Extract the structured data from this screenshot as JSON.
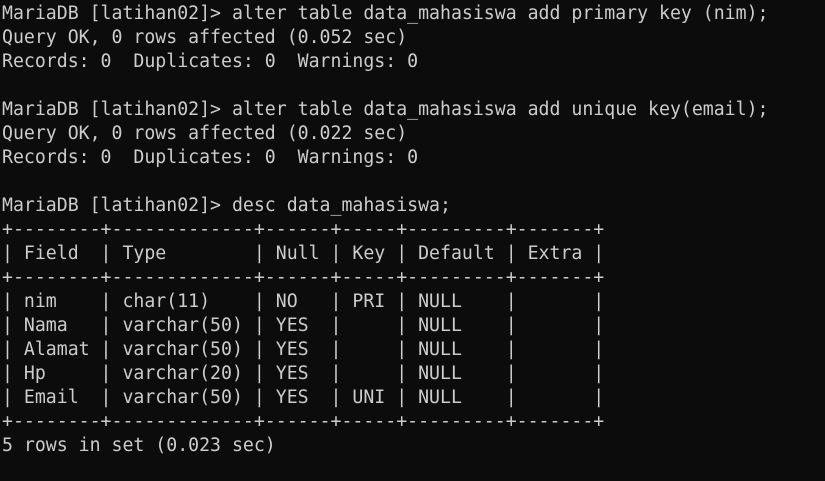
{
  "terminal": {
    "background": "#0c0c0c",
    "foreground": "#cccccc",
    "lines": [
      "MariaDB [latihan02]> alter table data_mahasiswa add primary key (nim);",
      "Query OK, 0 rows affected (0.052 sec)",
      "Records: 0  Duplicates: 0  Warnings: 0",
      "",
      "MariaDB [latihan02]> alter table data_mahasiswa add unique key(email);",
      "Query OK, 0 rows affected (0.022 sec)",
      "Records: 0  Duplicates: 0  Warnings: 0",
      "",
      "MariaDB [latihan02]> desc data_mahasiswa;",
      "+--------+-------------+------+-----+---------+-------+",
      "| Field  | Type        | Null | Key | Default | Extra |",
      "+--------+-------------+------+-----+---------+-------+",
      "| nim    | char(11)    | NO   | PRI | NULL    |       |",
      "| Nama   | varchar(50) | YES  |     | NULL    |       |",
      "| Alamat | varchar(50) | YES  |     | NULL    |       |",
      "| Hp     | varchar(20) | YES  |     | NULL    |       |",
      "| Email  | varchar(50) | YES  | UNI | NULL    |       |",
      "+--------+-------------+------+-----+---------+-------+",
      "5 rows in set (0.023 sec)"
    ]
  }
}
